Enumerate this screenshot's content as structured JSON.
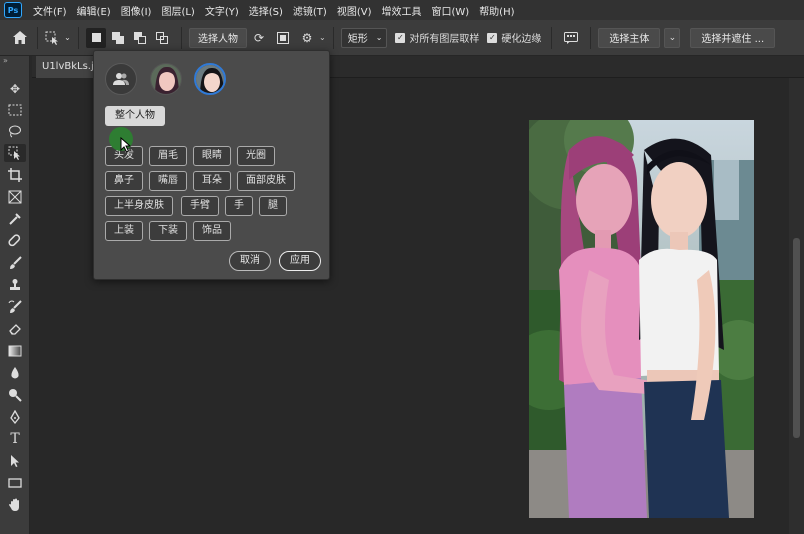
{
  "app": {
    "logo": "Ps"
  },
  "menu": [
    "文件(F)",
    "编辑(E)",
    "图像(I)",
    "图层(L)",
    "文字(Y)",
    "选择(S)",
    "滤镜(T)",
    "视图(V)",
    "增效工具",
    "窗口(W)",
    "帮助(H)"
  ],
  "options_bar": {
    "select_people": "选择人物",
    "shape_mode": "矩形",
    "sample_all_layers": "对所有图层取样",
    "hard_edge": "硬化边缘",
    "select_subject": "选择主体",
    "select_and_mask": "选择并遮住 ..."
  },
  "document": {
    "tab_name": "U1lvBkLs.jpg"
  },
  "popup": {
    "whole_person": "整个人物",
    "parts_row1": [
      "头发",
      "眉毛",
      "眼睛",
      "光圈"
    ],
    "parts_row2": [
      "鼻子",
      "嘴唇",
      "耳朵",
      "面部皮肤"
    ],
    "parts_row3": [
      "上半身皮肤",
      "手臂",
      "手",
      "腿"
    ],
    "parts_row4": [
      "上装",
      "下装",
      "饰品"
    ],
    "cancel": "取消",
    "apply": "应用"
  },
  "colors": {
    "accent": "#2f7ad8",
    "cursor_dot": "#2e7d32",
    "photo_selection_tint": "#c0609a"
  },
  "icons": [
    "home-icon",
    "object-select-tool-icon",
    "refresh-icon",
    "gear-icon",
    "move-tool-icon",
    "marquee-tool-icon",
    "lasso-tool-icon",
    "crop-tool-icon",
    "eyedropper-tool-icon",
    "brush-tool-icon",
    "type-tool-icon",
    "hand-tool-icon"
  ]
}
